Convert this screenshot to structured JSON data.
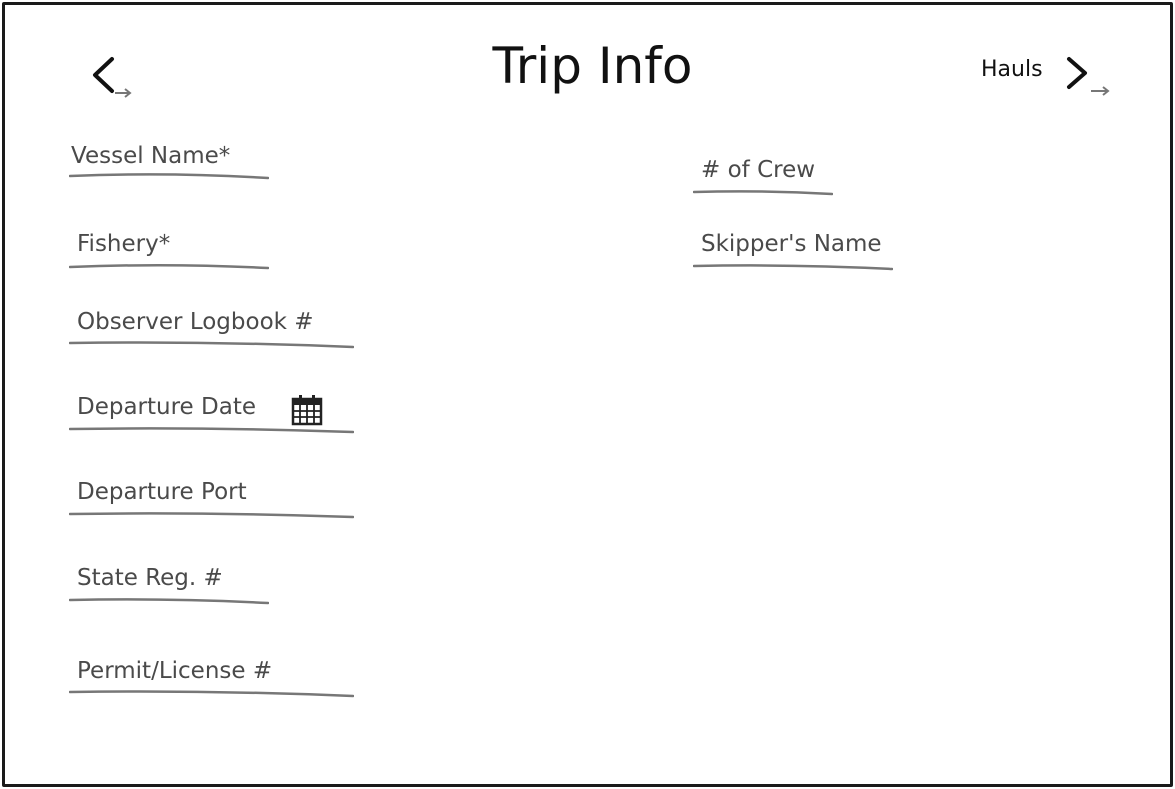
{
  "header": {
    "title": "Trip Info",
    "next_label": "Hauls"
  },
  "form": {
    "left_fields": [
      {
        "label": "Vessel Name*"
      },
      {
        "label": "Fishery*"
      },
      {
        "label": "Observer Logbook #"
      },
      {
        "label": "Departure Date",
        "icon": "calendar-icon"
      },
      {
        "label": "Departure Port"
      },
      {
        "label": "State Reg. #"
      },
      {
        "label": "Permit/License #"
      }
    ],
    "right_fields": [
      {
        "label": "# of Crew"
      },
      {
        "label": "Skipper's Name"
      }
    ]
  },
  "colors": {
    "frame": "#1a1a1a",
    "label": "#4a4a4a",
    "underline": "#777777"
  }
}
